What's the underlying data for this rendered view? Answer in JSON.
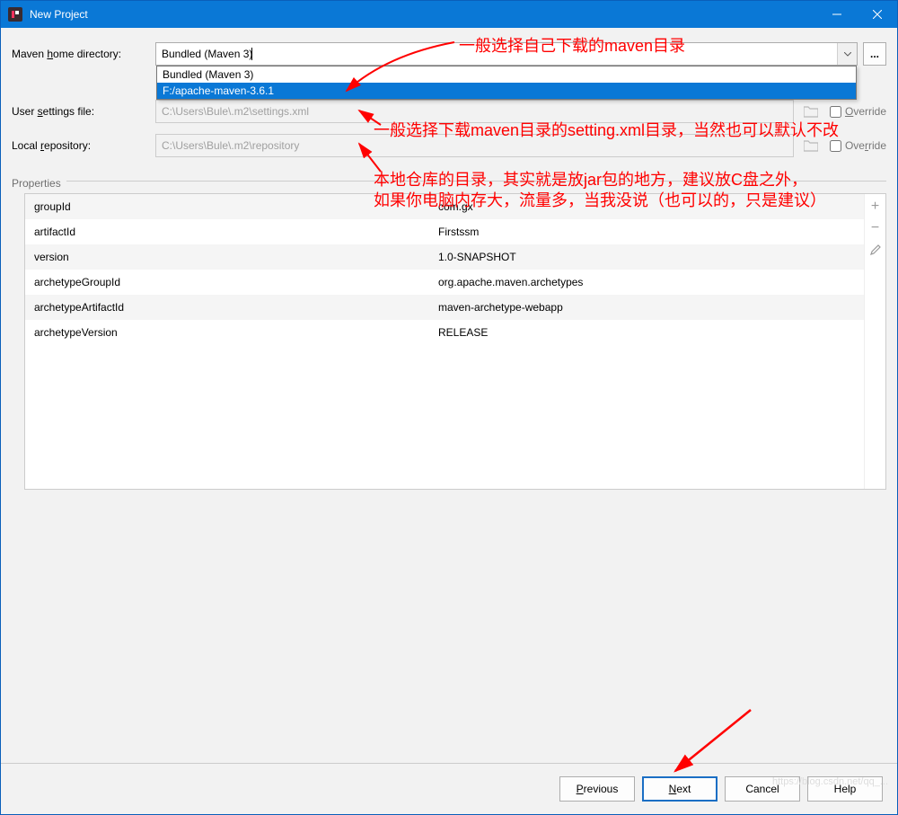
{
  "window": {
    "title": "New Project"
  },
  "fields": {
    "mavenHome": {
      "label_pre": "Maven ",
      "label_u": "h",
      "label_post": "ome directory:",
      "value": "Bundled (Maven 3)",
      "options": {
        "o0": "Bundled (Maven 3)",
        "o1": "F:/apache-maven-3.6.1"
      }
    },
    "userSettings": {
      "label_pre": "User ",
      "label_u": "s",
      "label_post": "ettings file:",
      "value": "C:\\Users\\Bule\\.m2\\settings.xml",
      "override_u": "O",
      "override_post": "verride"
    },
    "localRepo": {
      "label_pre": "Local ",
      "label_u": "r",
      "label_post": "epository:",
      "value": "C:\\Users\\Bule\\.m2\\repository",
      "override_pre": "Ove",
      "override_u": "r",
      "override_post": "ride"
    }
  },
  "propertiesHeader": "Properties",
  "properties": [
    {
      "name": "groupId",
      "value": "com.gx"
    },
    {
      "name": "artifactId",
      "value": "Firstssm"
    },
    {
      "name": "version",
      "value": "1.0-SNAPSHOT"
    },
    {
      "name": "archetypeGroupId",
      "value": "org.apache.maven.archetypes"
    },
    {
      "name": "archetypeArtifactId",
      "value": "maven-archetype-webapp"
    },
    {
      "name": "archetypeVersion",
      "value": "RELEASE"
    }
  ],
  "buttons": {
    "previous_u": "P",
    "previous_post": "revious",
    "next_u": "N",
    "next_post": "ext",
    "cancel": "Cancel",
    "help": "Help",
    "dots": "..."
  },
  "annotations": {
    "a1": "一般选择自己下载的maven目录",
    "a2": "一般选择下载maven目录的setting.xml目录，当然也可以默认不改",
    "a3_l1": "本地仓库的目录，其实就是放jar包的地方，建议放C盘之外，",
    "a3_l2": "如果你电脑内存大，流量多，当我没说（也可以的，只是建议）"
  },
  "watermark": "https://blog.csdn.net/qq_..."
}
